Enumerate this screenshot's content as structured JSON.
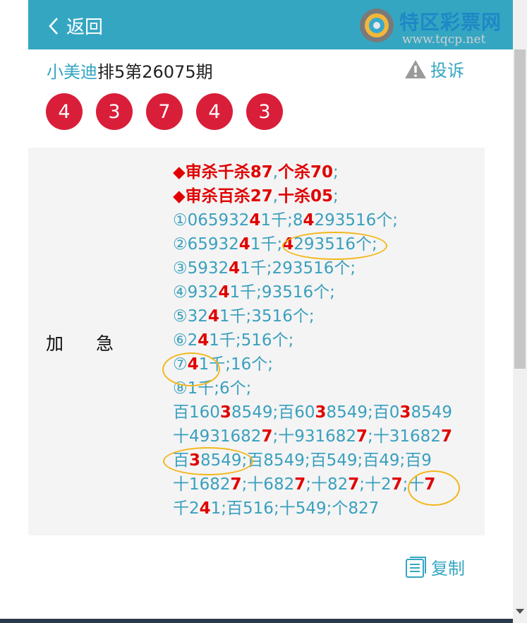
{
  "header": {
    "back_label": "返回",
    "logo_text": "特区彩票网",
    "logo_url": "www.tqcp.net"
  },
  "post": {
    "user": "小美迪",
    "title": "排5第26075期",
    "report_label": "投诉"
  },
  "balls": [
    "4",
    "3",
    "7",
    "4",
    "3"
  ],
  "entry": {
    "label": "加急",
    "lines": [
      [
        [
          "◆审杀千杀87",
          "hdr"
        ],
        [
          ",",
          "sep"
        ],
        [
          "个杀70",
          "hdr"
        ],
        [
          ";",
          "sep"
        ]
      ],
      [
        [
          "◆审杀百杀27",
          "hdr"
        ],
        [
          ",",
          "sep"
        ],
        [
          "十杀05",
          "hdr"
        ],
        [
          ";",
          "sep"
        ]
      ],
      [
        [
          "①065932",
          ""
        ],
        [
          "4",
          "hl"
        ],
        [
          "1千;8",
          ""
        ],
        [
          "4",
          "hl"
        ],
        [
          "293516个;",
          ""
        ]
      ],
      [
        [
          "②65932",
          ""
        ],
        [
          "4",
          "hl"
        ],
        [
          "1千;",
          ""
        ],
        [
          "4",
          "hl"
        ],
        [
          "293516个;",
          ""
        ]
      ],
      [
        [
          "③5932",
          ""
        ],
        [
          "4",
          "hl"
        ],
        [
          "1千;293516个;",
          ""
        ]
      ],
      [
        [
          "④932",
          ""
        ],
        [
          "4",
          "hl"
        ],
        [
          "1千;93516个;",
          ""
        ]
      ],
      [
        [
          "⑤32",
          ""
        ],
        [
          "4",
          "hl"
        ],
        [
          "1千;3516个;",
          ""
        ]
      ],
      [
        [
          "⑥2",
          ""
        ],
        [
          "4",
          "hl"
        ],
        [
          "1千;516个;",
          ""
        ]
      ],
      [
        [
          "⑦",
          ""
        ],
        [
          "4",
          "hl"
        ],
        [
          "1千;16个;",
          ""
        ]
      ],
      [
        [
          "⑧1千;6个;",
          ""
        ]
      ],
      [
        [
          "百160",
          ""
        ],
        [
          "3",
          "hl"
        ],
        [
          "8549;百60",
          ""
        ],
        [
          "3",
          "hl"
        ],
        [
          "8549;百0",
          ""
        ],
        [
          "3",
          "hl"
        ],
        [
          "8549",
          ""
        ]
      ],
      [
        [
          "十4931682",
          ""
        ],
        [
          "7",
          "hl"
        ],
        [
          ";十931682",
          ""
        ],
        [
          "7",
          "hl"
        ],
        [
          ";十31682",
          ""
        ],
        [
          "7",
          "hl"
        ]
      ],
      [
        [
          "百",
          ""
        ],
        [
          "3",
          "hl"
        ],
        [
          "8549;百8549;百549;百49;百9",
          ""
        ]
      ],
      [
        [
          "十1682",
          ""
        ],
        [
          "7",
          "hl"
        ],
        [
          ";十682",
          ""
        ],
        [
          "7",
          "hl"
        ],
        [
          ";十82",
          ""
        ],
        [
          "7",
          "hl"
        ],
        [
          ";十2",
          ""
        ],
        [
          "7",
          "hl"
        ],
        [
          ";十",
          ""
        ],
        [
          "7",
          "hl"
        ]
      ],
      [
        [
          "千2",
          ""
        ],
        [
          "4",
          "hl"
        ],
        [
          "1;百516;十549;个827",
          ""
        ]
      ]
    ]
  },
  "footer": {
    "copy_label": "复制"
  },
  "colors": {
    "accent": "#35a6c2",
    "ball": "#d91e3a",
    "highlight": "#e00000",
    "ring": "#f3b71c"
  }
}
